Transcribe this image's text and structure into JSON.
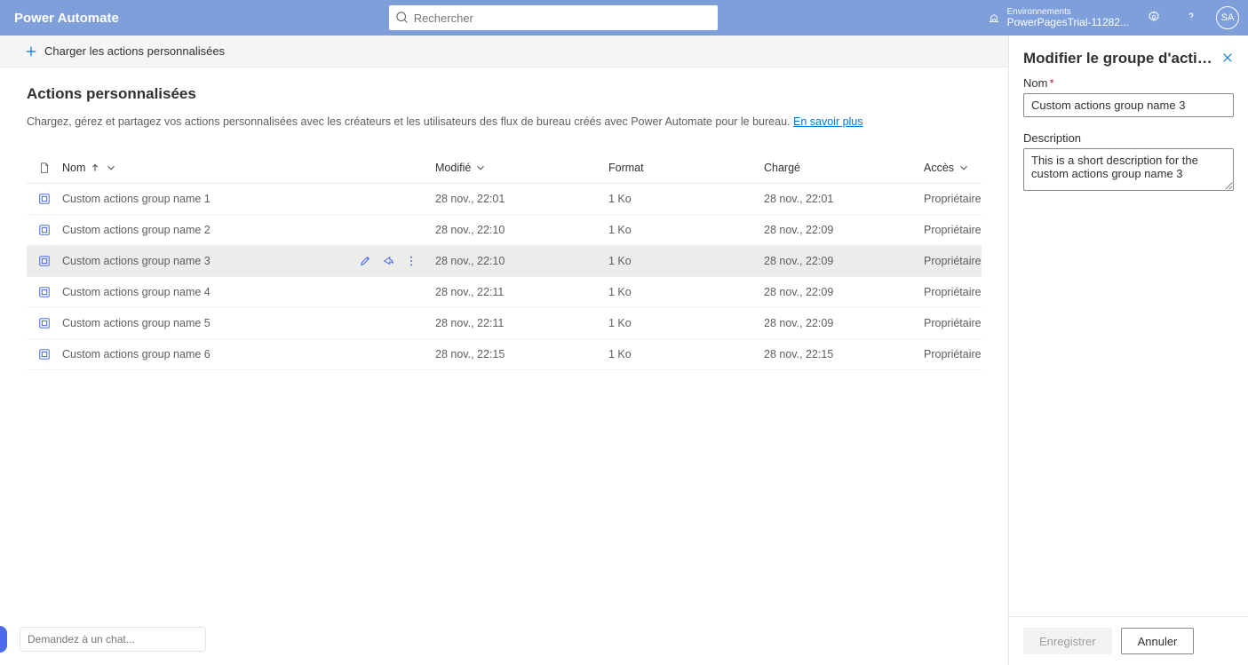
{
  "header": {
    "title": "Power Automate",
    "search_placeholder": "Rechercher",
    "env_label": "Environnements",
    "env_name": "PowerPagesTrial-11282...",
    "avatar_initials": "SA"
  },
  "toolbar": {
    "load_label": "Charger les actions personnalisées"
  },
  "page": {
    "title": "Actions personnalisées",
    "description": "Chargez, gérez et partagez vos actions personnalisées avec les créateurs et les utilisateurs des flux de bureau créés avec Power Automate pour le bureau. ",
    "learn_more": "En savoir plus"
  },
  "columns": {
    "name": "Nom",
    "modified": "Modifié",
    "format": "Format",
    "loaded": "Chargé",
    "access": "Accès"
  },
  "rows": [
    {
      "name": "Custom actions group name 1",
      "modified": "28 nov., 22:01",
      "format": "1 Ko",
      "loaded": "28 nov., 22:01",
      "access": "Propriétaire"
    },
    {
      "name": "Custom actions group name 2",
      "modified": "28 nov., 22:10",
      "format": "1 Ko",
      "loaded": "28 nov., 22:09",
      "access": "Propriétaire"
    },
    {
      "name": "Custom actions group name 3",
      "modified": "28 nov., 22:10",
      "format": "1 Ko",
      "loaded": "28 nov., 22:09",
      "access": "Propriétaire"
    },
    {
      "name": "Custom actions group name 4",
      "modified": "28 nov., 22:11",
      "format": "1 Ko",
      "loaded": "28 nov., 22:09",
      "access": "Propriétaire"
    },
    {
      "name": "Custom actions group name 5",
      "modified": "28 nov., 22:11",
      "format": "1 Ko",
      "loaded": "28 nov., 22:09",
      "access": "Propriétaire"
    },
    {
      "name": "Custom actions group name 6",
      "modified": "28 nov., 22:15",
      "format": "1 Ko",
      "loaded": "28 nov., 22:15",
      "access": "Propriétaire"
    }
  ],
  "selected_row_index": 2,
  "chat": {
    "placeholder": "Demandez à un chat..."
  },
  "panel": {
    "title": "Modifier le groupe d'actions...",
    "name_label": "Nom",
    "name_value": "Custom actions group name 3",
    "description_label": "Description",
    "description_value": "This is a short description for the custom actions group name 3",
    "save_label": "Enregistrer",
    "cancel_label": "Annuler"
  }
}
